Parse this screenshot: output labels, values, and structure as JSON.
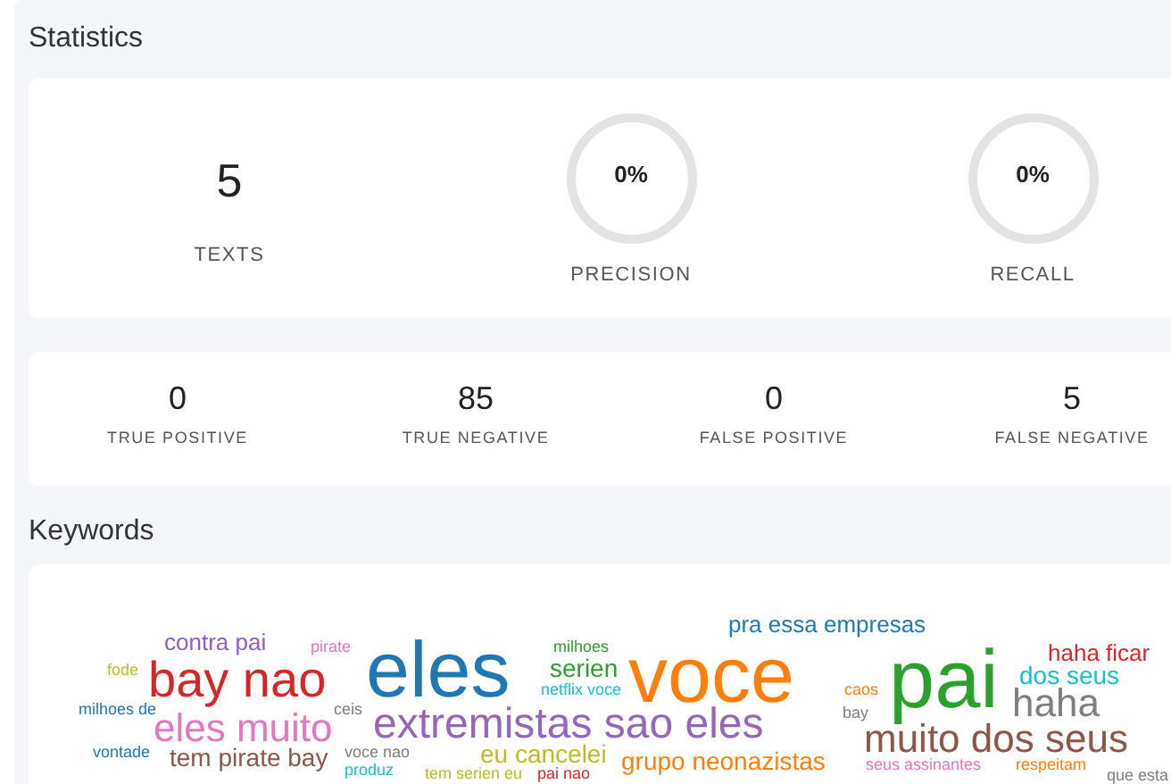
{
  "statistics": {
    "title": "Statistics",
    "summary": [
      {
        "kind": "number",
        "value": "5",
        "label": "TEXTS"
      },
      {
        "kind": "ring",
        "value": "0%",
        "label": "PRECISION",
        "level": 0
      },
      {
        "kind": "ring",
        "value": "0%",
        "label": "RECALL",
        "level": 0
      }
    ],
    "counts": [
      {
        "value": "0",
        "label": "TRUE POSITIVE"
      },
      {
        "value": "85",
        "label": "TRUE NEGATIVE"
      },
      {
        "value": "0",
        "label": "FALSE POSITIVE"
      },
      {
        "value": "5",
        "label": "FALSE NEGATIVE"
      }
    ]
  },
  "keywords": {
    "title": "Keywords",
    "words": [
      {
        "text": "contra pai",
        "color": "#8e5cc4"
      },
      {
        "text": "pirate",
        "color": "#e377c2"
      },
      {
        "text": "fode",
        "color": "#bcbd22"
      },
      {
        "text": "bay nao",
        "color": "#d62728"
      },
      {
        "text": "eles",
        "color": "#1f77b4"
      },
      {
        "text": "milhoes de",
        "color": "#1f77b4"
      },
      {
        "text": "ceis",
        "color": "#7f7f7f"
      },
      {
        "text": "eles muito",
        "color": "#e377c2"
      },
      {
        "text": "extremistas sao eles",
        "color": "#9467bd"
      },
      {
        "text": "vontade",
        "color": "#1f77b4"
      },
      {
        "text": "tem pirate bay",
        "color": "#8c564b"
      },
      {
        "text": "voce nao",
        "color": "#7f7f7f"
      },
      {
        "text": "produz",
        "color": "#17becf"
      },
      {
        "text": "milhoes",
        "color": "#2ca02c"
      },
      {
        "text": "serien",
        "color": "#2ca02c"
      },
      {
        "text": "netflix voce",
        "color": "#17becf"
      },
      {
        "text": "eu cancelei",
        "color": "#bcbd22"
      },
      {
        "text": "tem serien eu",
        "color": "#bcbd22"
      },
      {
        "text": "pai nao",
        "color": "#d62728"
      },
      {
        "text": "voce",
        "color": "#ff7f0e"
      },
      {
        "text": "pra essa empresas",
        "color": "#1f77b4"
      },
      {
        "text": "grupo neonazistas",
        "color": "#ff7f0e"
      },
      {
        "text": "caos",
        "color": "#ff7f0e"
      },
      {
        "text": "bay",
        "color": "#7f7f7f"
      },
      {
        "text": "pai",
        "color": "#2ca02c"
      },
      {
        "text": "haha ficar",
        "color": "#d62728"
      },
      {
        "text": "dos seus",
        "color": "#17becf"
      },
      {
        "text": "haha",
        "color": "#7f7f7f"
      },
      {
        "text": "muito dos seus",
        "color": "#8c564b"
      },
      {
        "text": "seus assinantes",
        "color": "#e377c2"
      },
      {
        "text": "respeitam",
        "color": "#ff7f0e"
      },
      {
        "text": "que esta",
        "color": "#7f7f7f"
      }
    ]
  }
}
